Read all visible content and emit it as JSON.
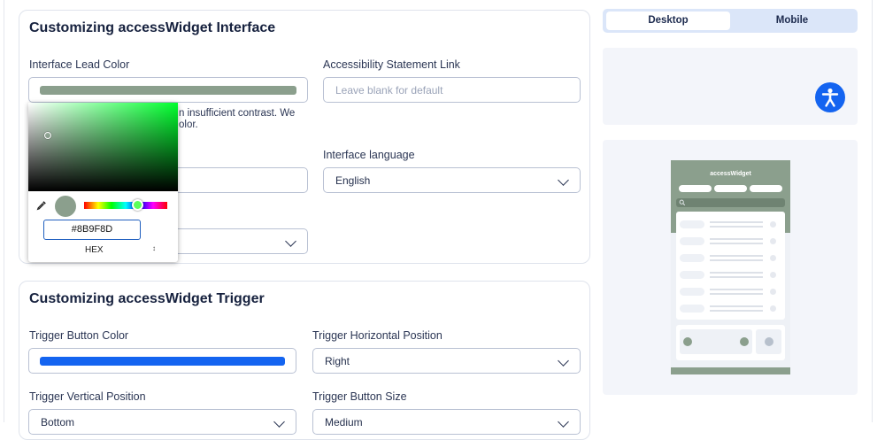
{
  "colors": {
    "lead": "#8B9F8D",
    "trigger": "#1464F0",
    "accent": "#1F5FBF"
  },
  "interface_card": {
    "title": "Customizing accessWidget Interface",
    "lead_color_label": "Interface Lead Color",
    "statement_link_label": "Accessibility Statement Link",
    "statement_link_placeholder": "Leave blank for default",
    "contrast_note_line1": "n insufficient contrast. We",
    "contrast_note_line2": "olor.",
    "language_label": "Interface language",
    "language_value": "English"
  },
  "color_picker": {
    "hex_value": "#8B9F8D",
    "mode": "HEX",
    "icons": {
      "eyedropper": "eyedropper-icon",
      "mode_toggle": "up-down-icon"
    }
  },
  "trigger_card": {
    "title": "Customizing accessWidget Trigger",
    "button_color_label": "Trigger Button Color",
    "horizontal_position_label": "Trigger Horizontal Position",
    "horizontal_position_value": "Right",
    "vertical_position_label": "Trigger Vertical Position",
    "vertical_position_value": "Bottom",
    "button_size_label": "Trigger Button Size",
    "button_size_value": "Medium"
  },
  "preview": {
    "tabs": [
      "Desktop",
      "Mobile"
    ],
    "active_tab": "Desktop",
    "widget_title": "accessWidget",
    "icons": {
      "accessibility": "accessibility-person-icon",
      "search": "search-icon"
    }
  }
}
